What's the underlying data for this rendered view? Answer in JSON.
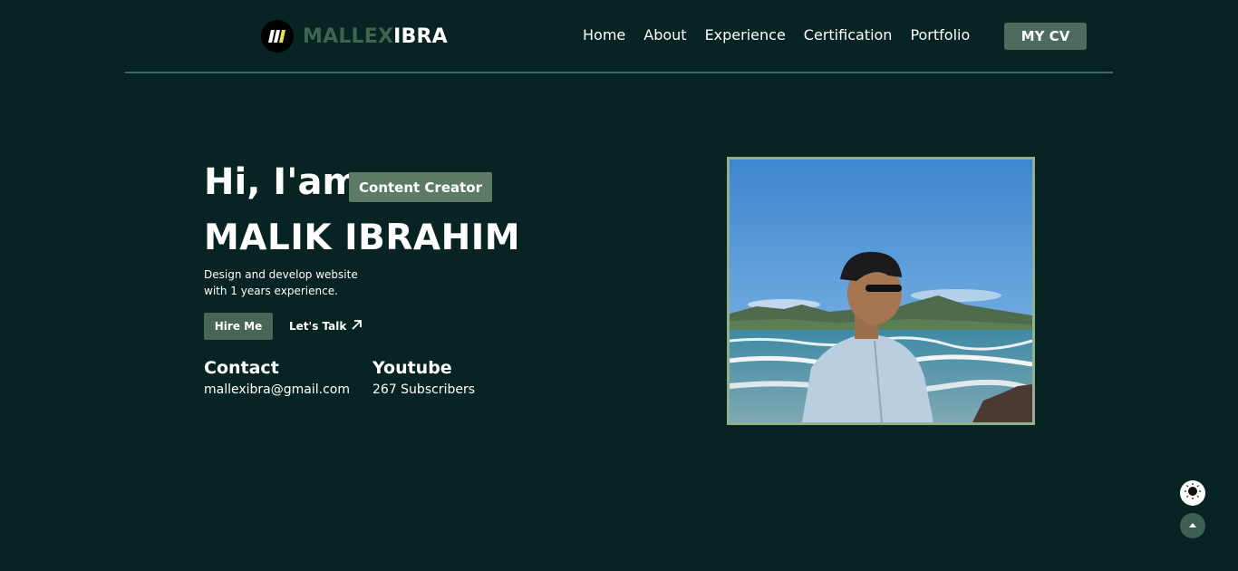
{
  "brand": {
    "part1": "MALLEX",
    "part2": "IBRA",
    "logo_icon": "logo-icon"
  },
  "nav": {
    "links": [
      "Home",
      "About",
      "Experience",
      "Certification",
      "Portfolio"
    ],
    "cv_label": "MY CV"
  },
  "hero": {
    "greeting": "Hi, I'am",
    "role_badge": "Content Creator",
    "name": "MALIK IBRAHIM",
    "desc_line1": "Design and develop website",
    "desc_line2": "with 1 years experience.",
    "hire_label": "Hire Me",
    "talk_label": "Let's Talk",
    "talk_icon": "arrow-up-right-icon"
  },
  "contact": {
    "heading": "Contact",
    "value": "mallexibra@gmail.com"
  },
  "youtube": {
    "heading": "Youtube",
    "value": "267 Subscribers"
  },
  "floating": {
    "theme_icon": "sun-icon",
    "top_icon": "chevron-up-icon"
  },
  "colors": {
    "background": "#072322",
    "accent": "#4d6b5e",
    "badge": "#5d7a65",
    "photo_border": "#93b08e"
  }
}
